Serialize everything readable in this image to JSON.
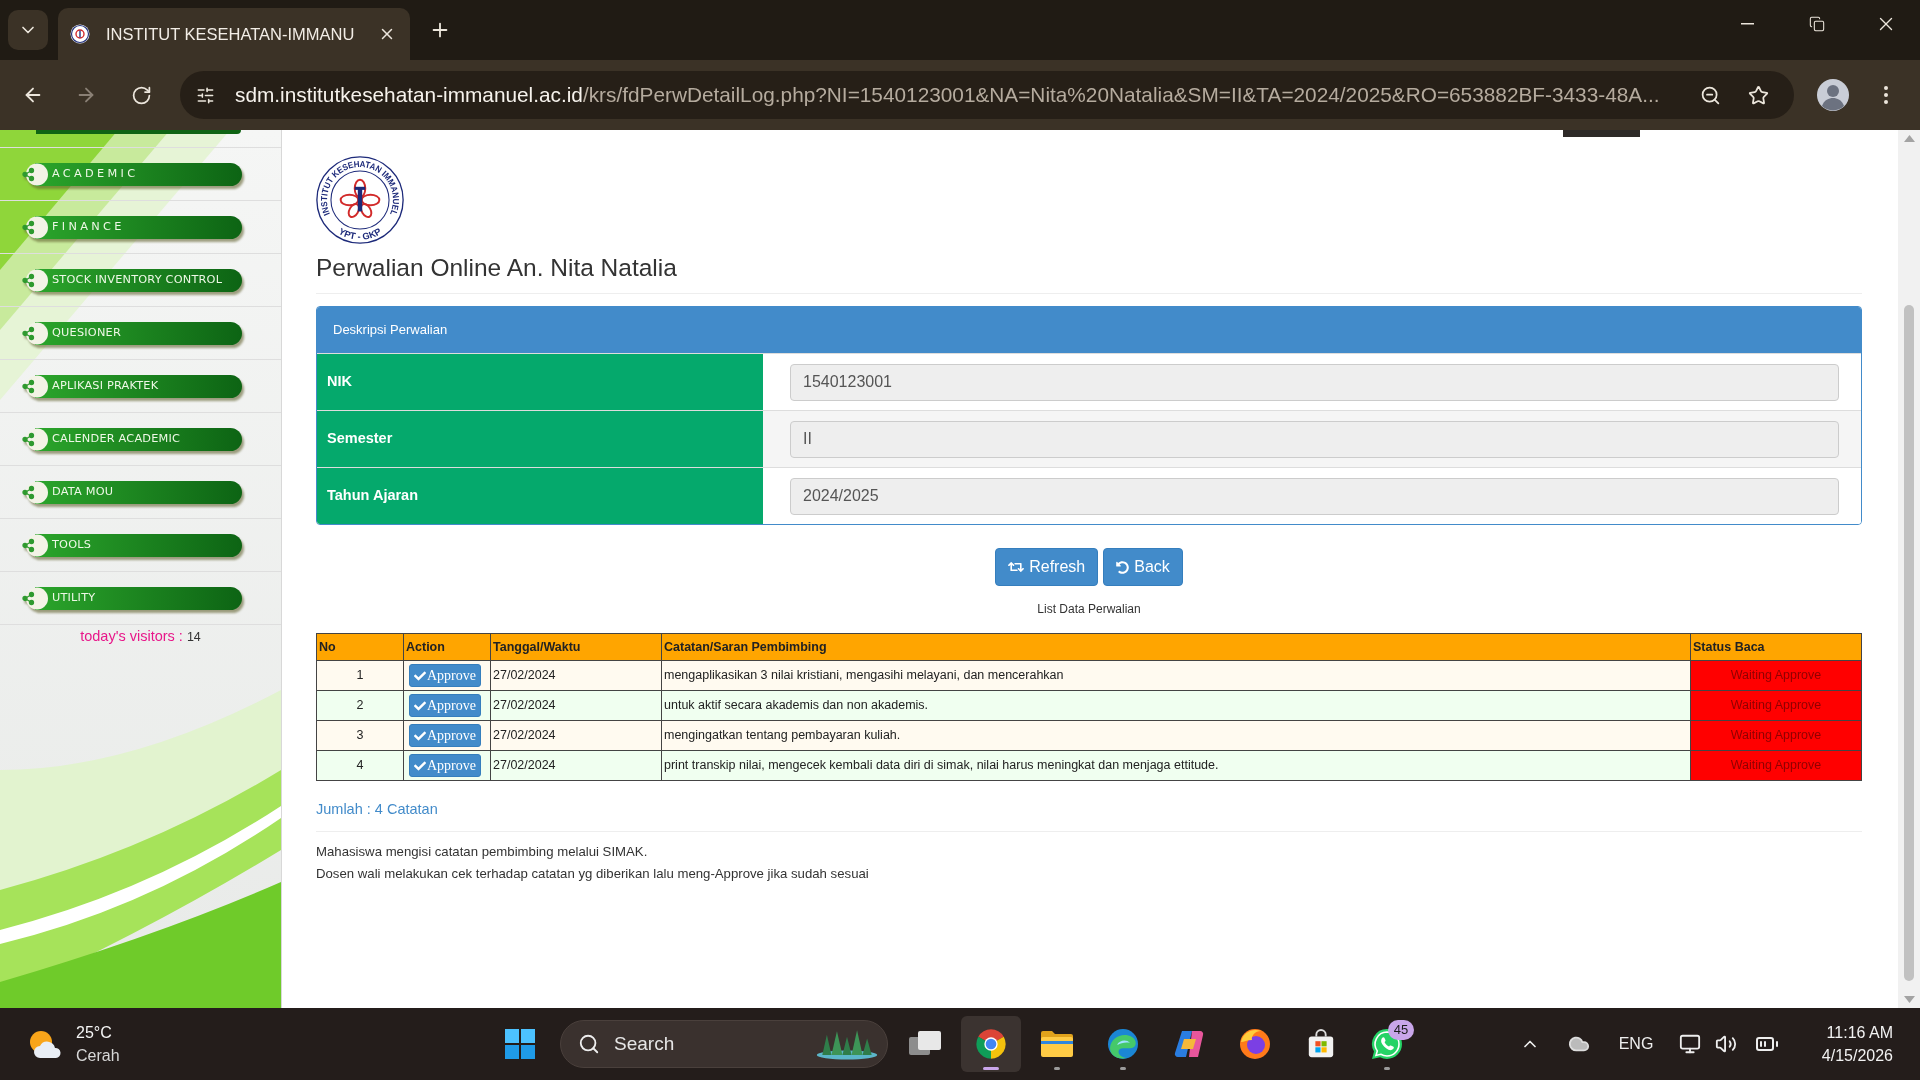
{
  "browser": {
    "tab": {
      "title": "INSTITUT KESEHATAN-IMMANU",
      "selected": true
    },
    "address": {
      "host": "sdm.institutkesehatan-immanuel.ac.id",
      "path": "/krs/fdPerwDetailLog.php?NI=1540123001&NA=Nita%20Natalia&SM=II&TA=2024/2025&RO=653882BF-3433-48A..."
    }
  },
  "sidebar": {
    "items": [
      {
        "label": "ACADEMIC",
        "spaced": true
      },
      {
        "label": "FINANCE",
        "spaced": true
      },
      {
        "label": "STOCK INVENTORY CONTROL",
        "spaced": false
      },
      {
        "label": "QUESIONER",
        "spaced": false
      },
      {
        "label": "APLIKASI PRAKTEK",
        "spaced": false
      },
      {
        "label": "CALENDER ACADEMIC",
        "spaced": false
      },
      {
        "label": "DATA MOU",
        "spaced": false
      },
      {
        "label": "TOOLS",
        "spaced": false
      },
      {
        "label": "UTILITY",
        "spaced": false
      }
    ],
    "visitors": {
      "label": "today's visitors :",
      "count": "14"
    }
  },
  "logo": {
    "ring_text": "INSTITUT KESEHATAN IMMANUEL",
    "bottom_text": "YPT - GKP"
  },
  "page": {
    "title": "Perwalian Online An. Nita Natalia"
  },
  "panel": {
    "title": "Deskripsi Perwalian",
    "fields": [
      {
        "label": "NIK",
        "value": "1540123001"
      },
      {
        "label": "Semester",
        "value": "II"
      },
      {
        "label": "Tahun Ajaran",
        "value": "2024/2025"
      }
    ]
  },
  "buttons": [
    {
      "kind": "refresh",
      "label": "Refresh"
    },
    {
      "kind": "back",
      "label": "Back"
    }
  ],
  "table": {
    "caption": "List Data Perwalian",
    "columns": [
      "No",
      "Action",
      "Tanggal/Waktu",
      "Catatan/Saran Pembimbing",
      "Status Baca"
    ],
    "rows": [
      {
        "no": "1",
        "action": "Approve",
        "date": "27/02/2024",
        "note": "mengaplikasikan 3 nilai kristiani, mengasihi melayani, dan mencerahkan",
        "status": "Waiting Approve"
      },
      {
        "no": "2",
        "action": "Approve",
        "date": "27/02/2024",
        "note": "untuk aktif secara akademis dan non akademis.",
        "status": "Waiting Approve"
      },
      {
        "no": "3",
        "action": "Approve",
        "date": "27/02/2024",
        "note": "mengingatkan tentang pembayaran kuliah.",
        "status": "Waiting Approve"
      },
      {
        "no": "4",
        "action": "Approve",
        "date": "27/02/2024",
        "note": "print transkip nilai, mengecek kembali data diri di simak, nilai harus meningkat dan menjaga ettitude.",
        "status": "Waiting Approve"
      }
    ]
  },
  "summary": "Jumlah : 4 Catatan",
  "notes": [
    "Mahasiswa mengisi catatan pembimbing melalui SIMAK.",
    "Dosen wali melakukan cek terhadap catatan yg diberikan lalu meng-Approve jika sudah sesuai"
  ],
  "taskbar": {
    "weather": {
      "temperature": "25°C",
      "condition": "Cerah"
    },
    "search": {
      "placeholder": "Search"
    },
    "apps": [
      {
        "kind": "task-view",
        "running": false,
        "selected": false
      },
      {
        "kind": "chrome",
        "running": true,
        "selected": true
      },
      {
        "kind": "files",
        "running": true,
        "selected": false
      },
      {
        "kind": "edge",
        "running": true,
        "selected": false
      },
      {
        "kind": "copilot",
        "running": false,
        "selected": false
      },
      {
        "kind": "firefox",
        "running": false,
        "selected": false
      },
      {
        "kind": "store",
        "running": false,
        "selected": false
      },
      {
        "kind": "whatsapp",
        "running": true,
        "selected": false,
        "badge": "45"
      }
    ],
    "language": "ENG",
    "time": "11:16 AM",
    "date": "4/15/2026"
  }
}
